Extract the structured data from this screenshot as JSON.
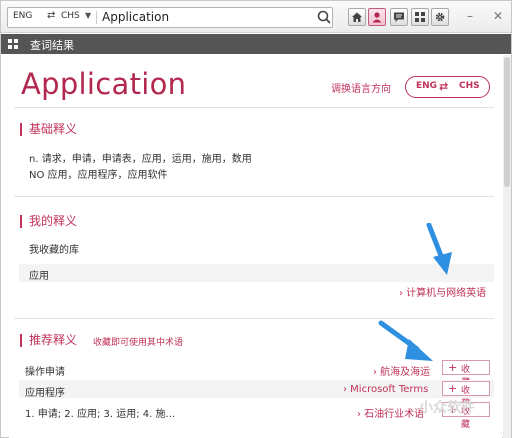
{
  "toolbar": {
    "source_lang": "ENG",
    "swap_symbol": "⇄",
    "target_lang": "CHS",
    "query_value": "Application",
    "icons": [
      "search-icon",
      "home-icon",
      "user-icon",
      "chat-icon",
      "grid-icon",
      "gear-icon"
    ],
    "minimize_symbol": "–",
    "close_symbol": "✕"
  },
  "header": {
    "title": "查词结果"
  },
  "entry": {
    "word": "Application",
    "direction_label": "调换语言方向",
    "direction_from": "ENG",
    "direction_arrow": "⇄",
    "direction_to": "CHS"
  },
  "basic": {
    "title": "基础释义",
    "lines": [
      "n. 请求，申请，申请表，应用，运用，施用，数用",
      "NO 应用，应用程序，应用软件"
    ]
  },
  "mine": {
    "title": "我的释义",
    "library_label": "我收藏的库",
    "item": "应用",
    "source": "› 计算机与网络英语"
  },
  "recommend": {
    "title": "推荐释义",
    "hint": "收藏即可使用其中术语",
    "fav_label": "收 藏",
    "rows": [
      {
        "term": "操作申请",
        "source": "› 航海及海运"
      },
      {
        "term": "应用程序",
        "source": "› Microsoft Terms"
      },
      {
        "term": "1. 申请; 2. 应用; 3. 运用; 4. 施...",
        "source": "› 石油行业术语"
      }
    ]
  },
  "watermark": "小众软件",
  "colors": {
    "accent": "#c0325a",
    "header_bg": "#555555",
    "arrow": "#2f8fe0"
  }
}
